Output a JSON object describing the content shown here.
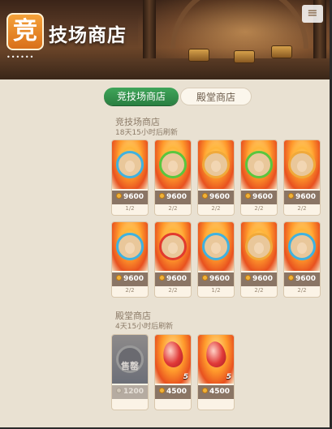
{
  "header": {
    "badge_char": "竞",
    "title": "技场商店",
    "dots": "••••••",
    "window_icon": "≡"
  },
  "tabs": [
    {
      "label": "竞技场商店",
      "active": true
    },
    {
      "label": "殿堂商店",
      "active": false
    }
  ],
  "arena_shop": {
    "title": "竞技场商店",
    "refresh": "18天15小时后刷新",
    "items": [
      {
        "price": "9600",
        "stock": "1/2",
        "ring": "blue",
        "icon": "hero-portrait"
      },
      {
        "price": "9600",
        "stock": "2/2",
        "ring": "green",
        "icon": "hero-portrait"
      },
      {
        "price": "9600",
        "stock": "2/2",
        "ring": "orange",
        "icon": "hero-portrait"
      },
      {
        "price": "9600",
        "stock": "2/2",
        "ring": "green",
        "icon": "hero-portrait"
      },
      {
        "price": "9600",
        "stock": "2/2",
        "ring": "orange",
        "icon": "hero-portrait"
      },
      {
        "price": "9600",
        "stock": "2/2",
        "ring": "blue",
        "icon": "hero-portrait"
      },
      {
        "price": "9600",
        "stock": "2/2",
        "ring": "red",
        "icon": "hero-portrait"
      },
      {
        "price": "9600",
        "stock": "1/2",
        "ring": "blue",
        "icon": "hero-portrait"
      },
      {
        "price": "9600",
        "stock": "2/2",
        "ring": "orange",
        "icon": "hero-portrait"
      },
      {
        "price": "9600",
        "stock": "2/2",
        "ring": "blue",
        "icon": "hero-portrait"
      }
    ]
  },
  "hall_shop": {
    "title": "殿堂商店",
    "refresh": "4天15小时后刷新",
    "items": [
      {
        "price": "1200",
        "stock": "",
        "sold_out": true,
        "sold_label": "售罄",
        "icon": "sold-out-card"
      },
      {
        "price": "4500",
        "stock": "",
        "qty": "5",
        "icon": "red-gem-icon"
      },
      {
        "price": "4500",
        "stock": "",
        "qty": "5",
        "icon": "red-gem-icon"
      }
    ]
  },
  "colors": {
    "ring_blue": "#3fb2e0",
    "ring_green": "#5ac63e",
    "ring_orange": "#f0a93a",
    "ring_red": "#e23a2e",
    "tab_active": "#2f8a48"
  }
}
